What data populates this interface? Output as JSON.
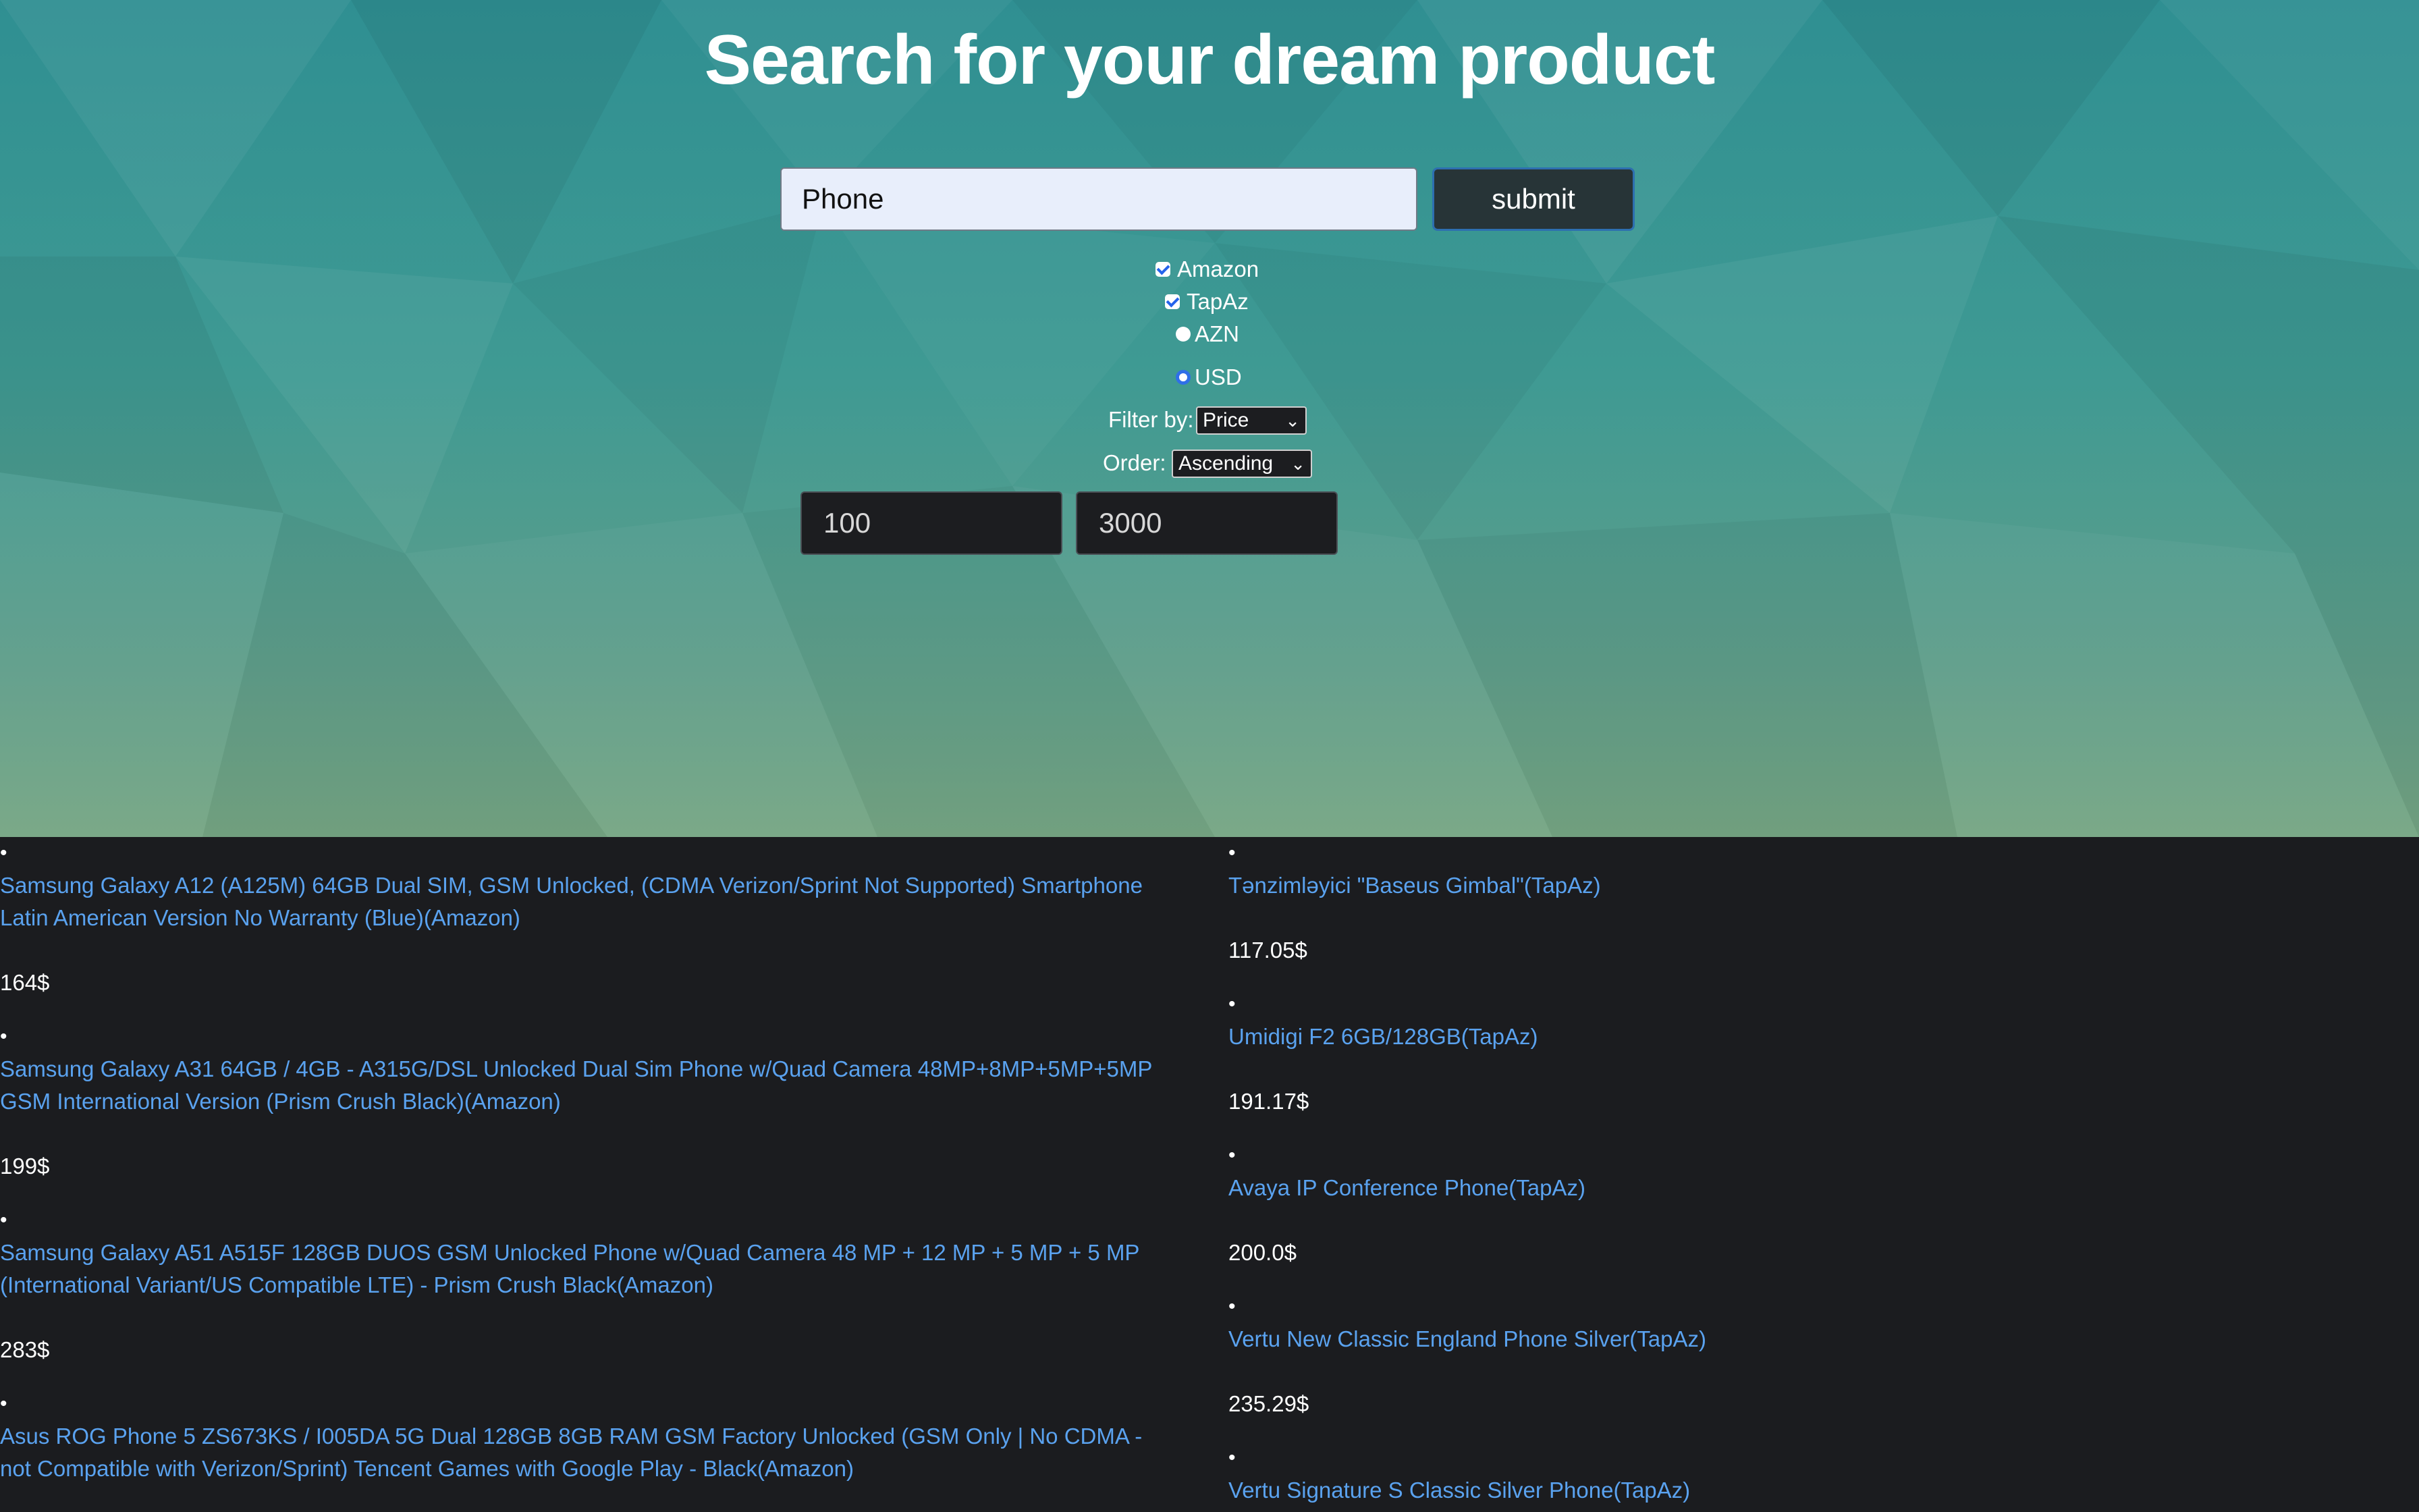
{
  "page": {
    "title": "Search for your dream product"
  },
  "search": {
    "value": "Phone",
    "submit_label": "submit"
  },
  "sources": [
    {
      "label": "Amazon",
      "checked": true
    },
    {
      "label": "TapAz",
      "checked": true
    }
  ],
  "currency": [
    {
      "label": "AZN",
      "selected": false
    },
    {
      "label": "USD",
      "selected": true
    }
  ],
  "filter": {
    "label": "Filter by:",
    "value": "Price"
  },
  "order": {
    "label": "Order:",
    "value": "Ascending"
  },
  "price_range": {
    "min": "100",
    "max": "3000"
  },
  "results_left": [
    {
      "title": "Samsung Galaxy A12 (A125M) 64GB Dual SIM, GSM Unlocked, (CDMA Verizon/Sprint Not Supported) Smartphone Latin American Version No Warranty (Blue)(Amazon)",
      "price": "164$"
    },
    {
      "title": "Samsung Galaxy A31 64GB / 4GB - A315G/DSL Unlocked Dual Sim Phone w/Quad Camera 48MP+8MP+5MP+5MP GSM International Version (Prism Crush Black)(Amazon)",
      "price": "199$"
    },
    {
      "title": "Samsung Galaxy A51 A515F 128GB DUOS GSM Unlocked Phone w/Quad Camera 48 MP + 12 MP + 5 MP + 5 MP (International Variant/US Compatible LTE) - Prism Crush Black(Amazon)",
      "price": "283$"
    },
    {
      "title": "Asus ROG Phone 5 ZS673KS / I005DA 5G Dual 128GB 8GB RAM GSM Factory Unlocked (GSM Only | No CDMA - not Compatible with Verizon/Sprint) Tencent Games with Google Play - Black(Amazon)",
      "price": ""
    }
  ],
  "results_right": [
    {
      "title": "Tənzimləyici \"Baseus Gimbal\"(TapAz)",
      "price": "117.05$"
    },
    {
      "title": "Umidigi F2 6GB/128GB(TapAz)",
      "price": "191.17$"
    },
    {
      "title": "Avaya IP Conference Phone(TapAz)",
      "price": "200.0$"
    },
    {
      "title": "Vertu New Classic England Phone Silver(TapAz)",
      "price": "235.29$"
    },
    {
      "title": "Vertu Signature S Classic Silver Phone(TapAz)",
      "price": ""
    }
  ],
  "colors": {
    "accent": "#2f6fe8",
    "link": "#5aa2ef",
    "background": "#1b1c1f"
  }
}
